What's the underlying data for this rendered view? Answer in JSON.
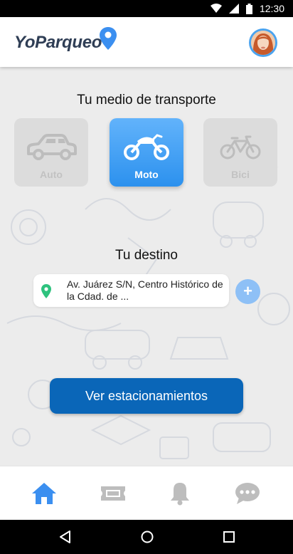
{
  "status_bar": {
    "time": "12:30",
    "icons": [
      "wifi-icon",
      "signal-icon",
      "battery-icon"
    ]
  },
  "app_bar": {
    "logo_text": "YoParqueo",
    "logo_icon": "map-pin-icon",
    "avatar": "user-avatar"
  },
  "transport": {
    "title": "Tu medio de transporte",
    "modes": [
      {
        "label": "Auto",
        "icon": "car-icon",
        "selected": false
      },
      {
        "label": "Moto",
        "icon": "motorcycle-icon",
        "selected": true
      },
      {
        "label": "Bici",
        "icon": "bicycle-icon",
        "selected": false
      }
    ]
  },
  "destination": {
    "title": "Tu destino",
    "address": "Av. Juárez S/N, Centro Histórico de la Cdad. de ...",
    "pin_icon": "location-pin-icon",
    "add_label": "+"
  },
  "cta": {
    "label": "Ver estacionamientos"
  },
  "tab_bar": {
    "items": [
      "home-icon",
      "ticket-icon",
      "bell-icon",
      "chat-icon"
    ],
    "active": "home-icon"
  },
  "system_nav": [
    "back-icon",
    "home-circle-icon",
    "recents-icon"
  ],
  "colors": {
    "accent": "#2c91ee",
    "cta": "#0a66b8",
    "pin": "#2ec27e",
    "logo": "#2f3e55",
    "inactive": "#bdbdbd"
  }
}
